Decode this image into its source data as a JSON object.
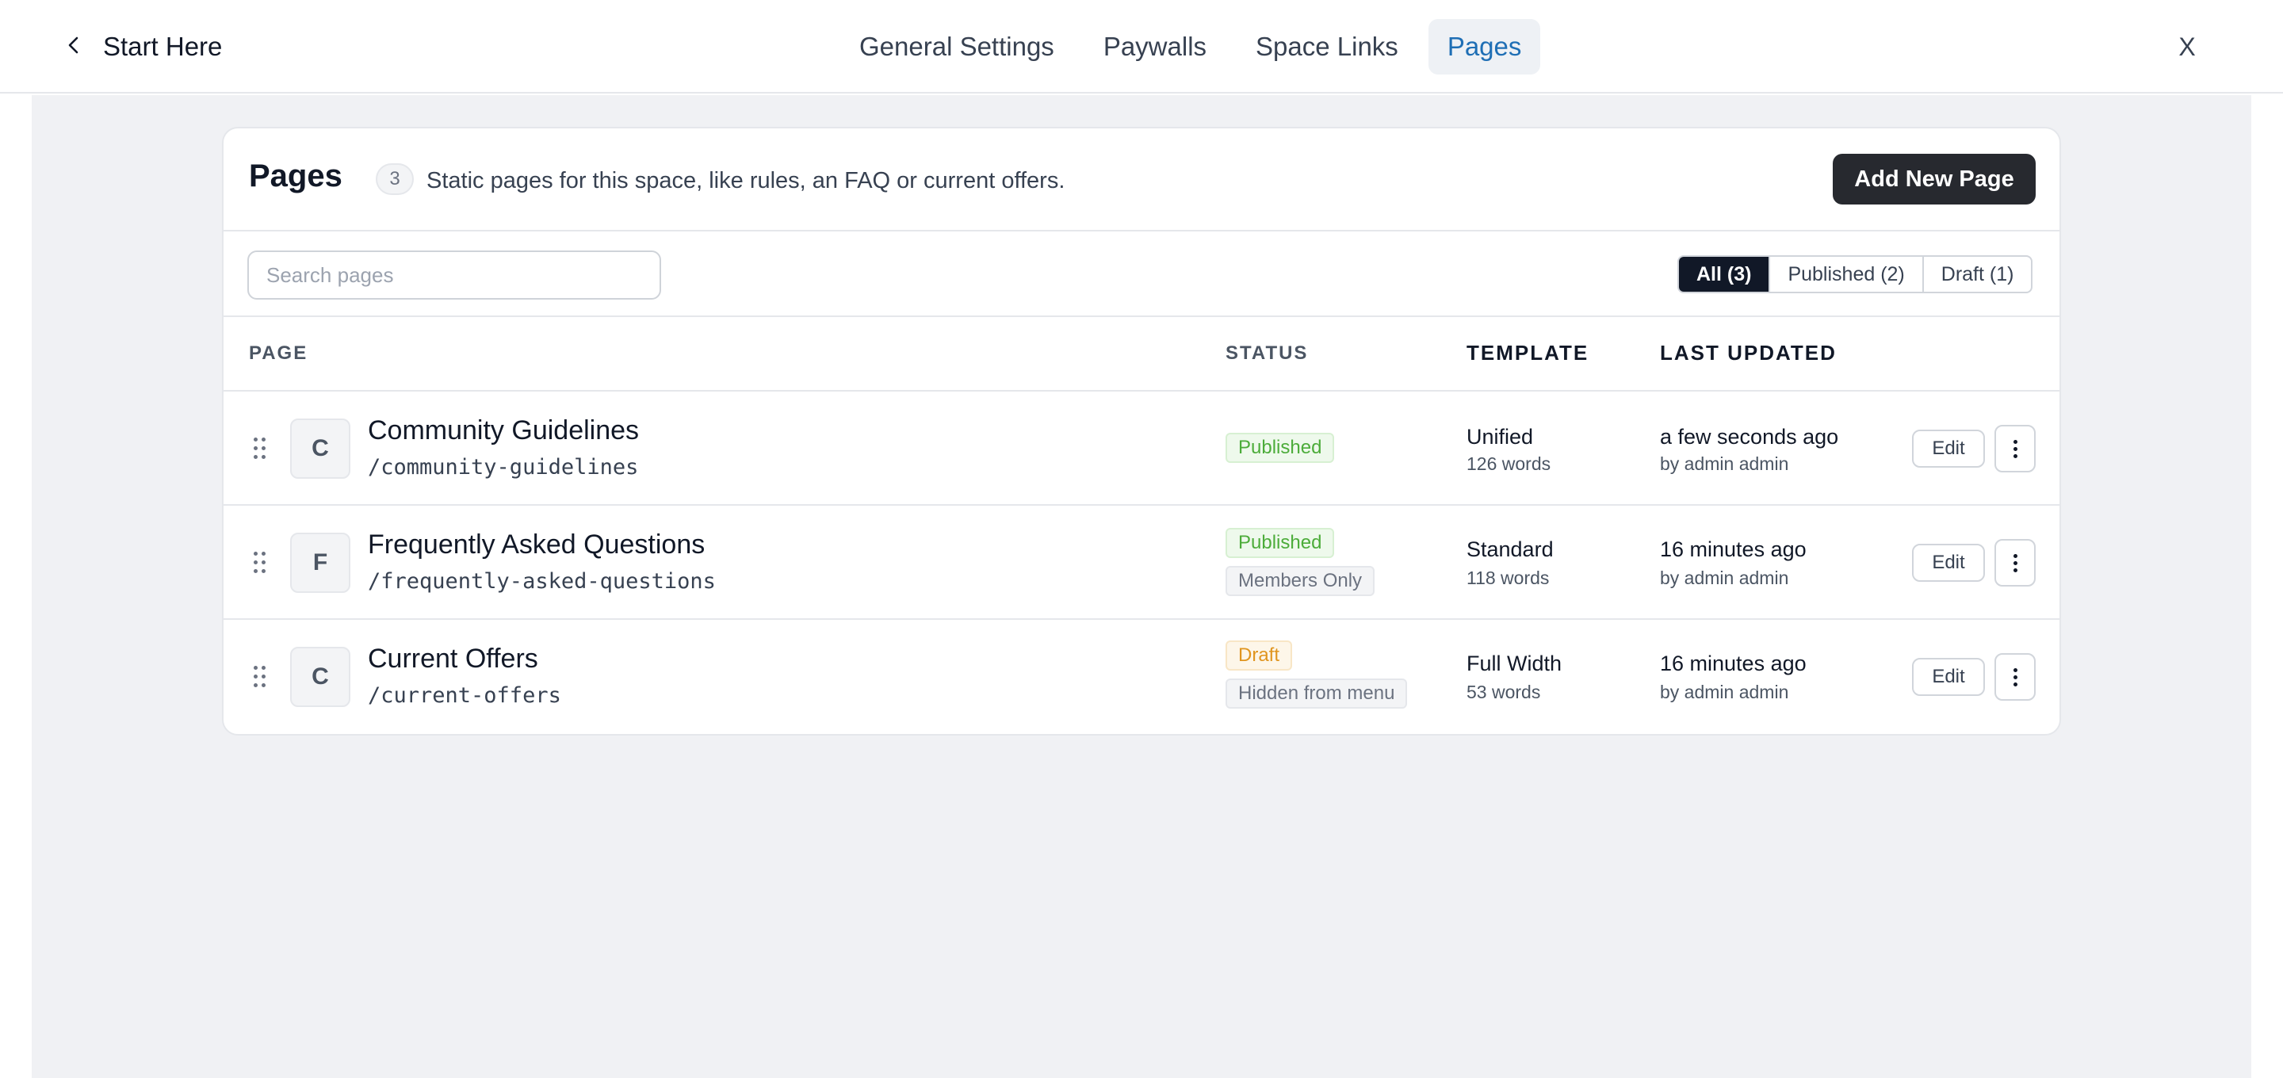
{
  "header": {
    "back_label": "Start Here",
    "tabs": [
      {
        "label": "General Settings",
        "active": false
      },
      {
        "label": "Paywalls",
        "active": false
      },
      {
        "label": "Space Links",
        "active": false
      },
      {
        "label": "Pages",
        "active": true
      }
    ],
    "close_label": "X"
  },
  "pages_panel": {
    "title": "Pages",
    "count": "3",
    "description": "Static pages for this space, like rules, an FAQ or current offers.",
    "add_button": "Add New Page",
    "search": {
      "placeholder": "Search pages",
      "value": ""
    },
    "filters": [
      {
        "label": "All (3)",
        "active": true
      },
      {
        "label": "Published (2)",
        "active": false
      },
      {
        "label": "Draft (1)",
        "active": false
      }
    ],
    "columns": {
      "page": "PAGE",
      "status": "STATUS",
      "template": "TEMPLATE",
      "last_updated": "LAST UPDATED"
    },
    "rows": [
      {
        "letter": "C",
        "title": "Community Guidelines",
        "slug": "/community-guidelines",
        "status": "Published",
        "extra_badge": "",
        "template": "Unified",
        "words": "126 words",
        "updated": "a few seconds ago",
        "by": "by admin admin",
        "edit_label": "Edit"
      },
      {
        "letter": "F",
        "title": "Frequently Asked Questions",
        "slug": "/frequently-asked-questions",
        "status": "Published",
        "extra_badge": "Members Only",
        "template": "Standard",
        "words": "118 words",
        "updated": "16 minutes ago",
        "by": "by admin admin",
        "edit_label": "Edit"
      },
      {
        "letter": "C",
        "title": "Current Offers",
        "slug": "/current-offers",
        "status": "Draft",
        "extra_badge": "Hidden from menu",
        "template": "Full Width",
        "words": "53 words",
        "updated": "16 minutes ago",
        "by": "by admin admin",
        "edit_label": "Edit"
      }
    ]
  },
  "colors": {
    "active_tab_text": "#1f6fb5",
    "primary_button": "#27292f",
    "published": "#4cac3a",
    "draft": "#e0951f",
    "page_background": "#f0f1f4"
  },
  "icons": {
    "back": "chevron-left-icon",
    "drag": "drag-handle-icon",
    "more": "vertical-dots-icon"
  }
}
